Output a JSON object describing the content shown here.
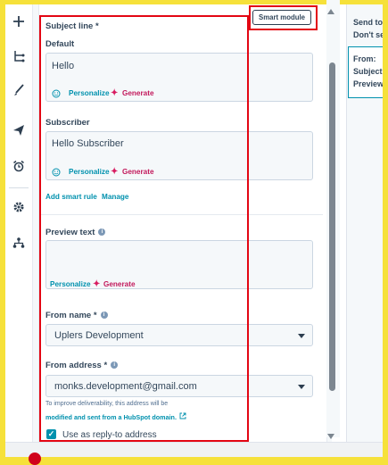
{
  "smart_module_label": "Smart module",
  "subject": {
    "label": "Subject line *",
    "default_label": "Default",
    "default_value": "Hello",
    "subscriber_label": "Subscriber",
    "subscriber_value": "Hello Subscriber",
    "personalize": "Personalize",
    "generate": "Generate",
    "add_smart_rule": "Add smart rule",
    "manage": "Manage"
  },
  "preview": {
    "label": "Preview text",
    "value": "",
    "personalize": "Personalize",
    "generate": "Generate"
  },
  "from_name": {
    "label": "From name *",
    "value": "Uplers Development"
  },
  "from_address": {
    "label": "From address *",
    "value": "monks.development@gmail.com",
    "note": "To improve deliverability, this address will be",
    "note_link": "modified and sent from a HubSpot domain."
  },
  "reply_to": {
    "label": "Use as reply-to address",
    "checked": true
  },
  "right_panel": {
    "send_to": "Send to",
    "dont_send": "Don't send",
    "from": "From:",
    "subject": "Subject",
    "preview": "Preview"
  },
  "colors": {
    "highlight": "#e30613",
    "accent": "#0091ae",
    "generate": "#c2185b",
    "frame": "#f6e13a"
  }
}
